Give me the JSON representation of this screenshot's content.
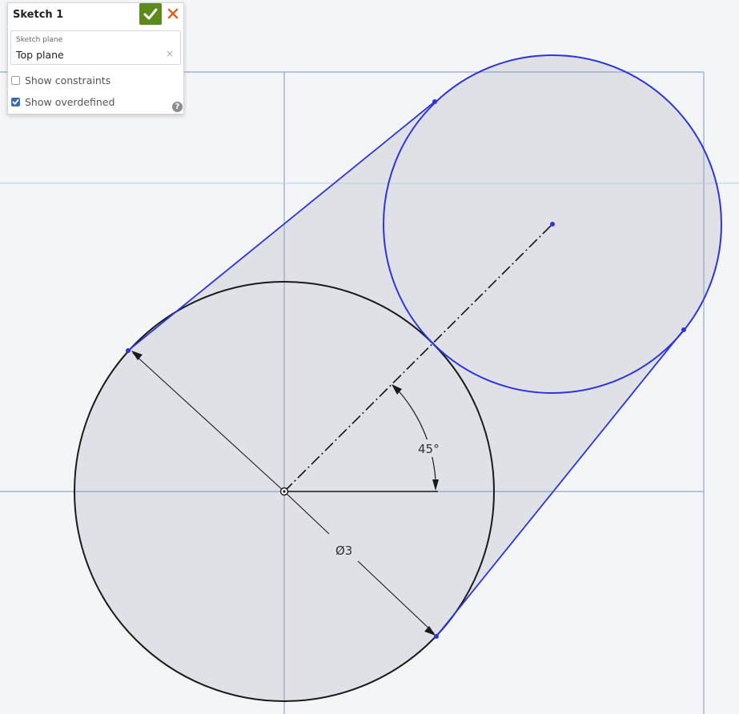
{
  "sketch_panel": {
    "title": "Sketch 1",
    "accept_icon": "check-icon",
    "cancel_icon": "close-icon",
    "sketch_plane": {
      "label": "Sketch plane",
      "value": "Top plane",
      "clear_glyph": "×"
    },
    "options": [
      {
        "label": "Show constraints",
        "checked": false
      },
      {
        "label": "Show overdefined",
        "checked": true
      }
    ],
    "help_glyph": "?"
  },
  "canvas": {
    "angle_dimension": "45°",
    "diameter_dimension": "Ø3"
  },
  "colors": {
    "accept_green": "#5c8a1b",
    "cancel_orange": "#d4652b",
    "sketch_blue": "#2a35dd",
    "profile_fill": "#dfe1e6",
    "plane_line": "#8fa6c8",
    "checkbox_blue": "#3b6db5"
  }
}
